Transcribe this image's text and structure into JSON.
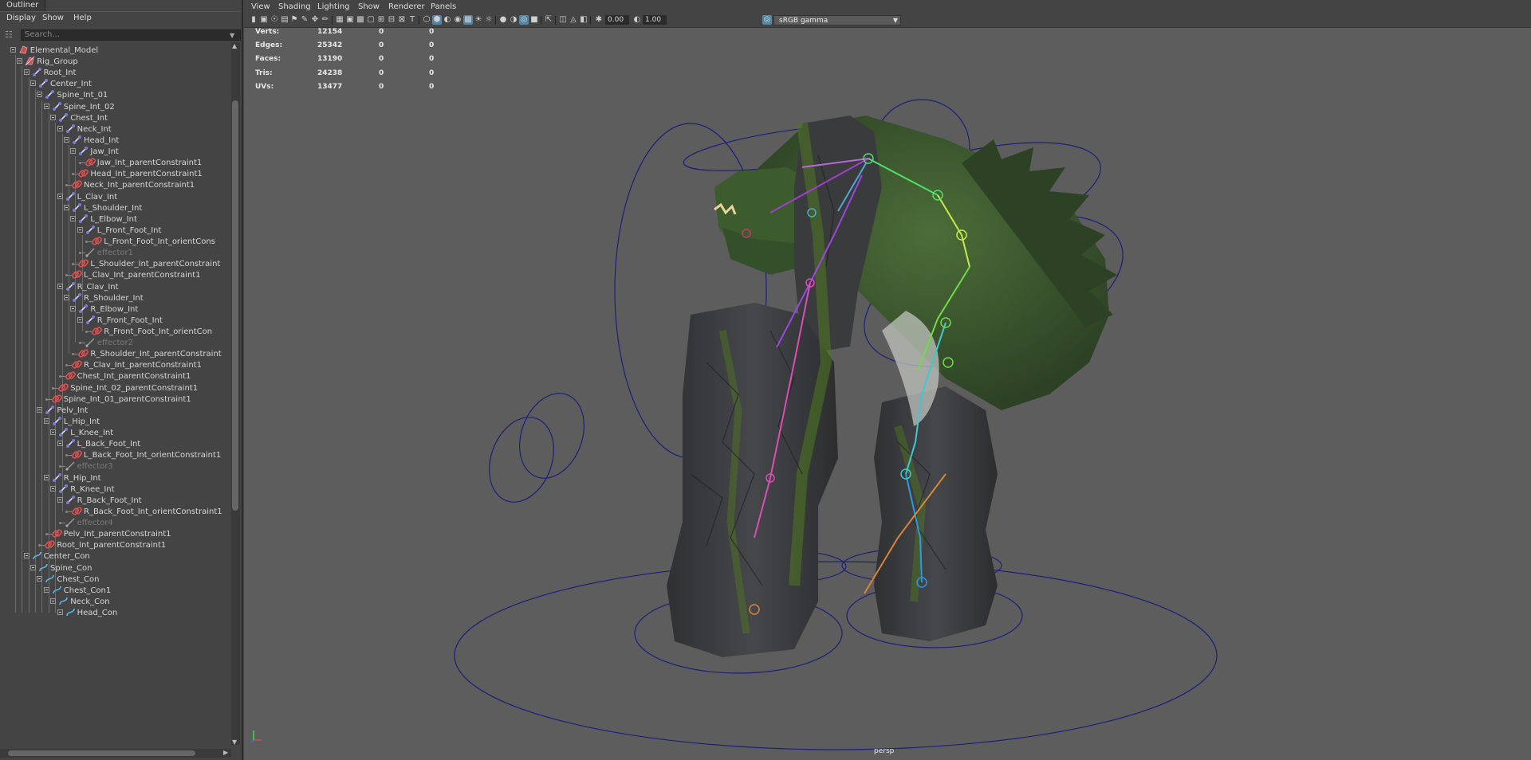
{
  "outliner": {
    "tab": "Outliner",
    "menu": [
      "Display",
      "Show",
      "Help"
    ],
    "search_placeholder": "Search...",
    "items": [
      {
        "label": "Elemental_Model",
        "depth": 2,
        "icon": "mesh",
        "expand": true
      },
      {
        "label": "Rig_Group",
        "depth": 3,
        "icon": "group",
        "expand": true
      },
      {
        "label": "Root_Int",
        "depth": 4,
        "icon": "joint",
        "expand": true
      },
      {
        "label": "Center_Int",
        "depth": 5,
        "icon": "joint",
        "expand": true
      },
      {
        "label": "Spine_Int_01",
        "depth": 6,
        "icon": "joint",
        "expand": true
      },
      {
        "label": "Spine_Int_02",
        "depth": 7,
        "icon": "joint",
        "expand": true
      },
      {
        "label": "Chest_Int",
        "depth": 8,
        "icon": "joint",
        "expand": true
      },
      {
        "label": "Neck_Int",
        "depth": 9,
        "icon": "joint",
        "expand": true
      },
      {
        "label": "Head_Int",
        "depth": 10,
        "icon": "joint",
        "expand": true
      },
      {
        "label": "Jaw_Int",
        "depth": 11,
        "icon": "joint",
        "expand": true
      },
      {
        "label": "Jaw_Int_parentConstraint1",
        "depth": 12,
        "icon": "constraint",
        "expand": false
      },
      {
        "label": "Head_Int_parentConstraint1",
        "depth": 11,
        "icon": "constraint",
        "expand": false
      },
      {
        "label": "Neck_Int_parentConstraint1",
        "depth": 10,
        "icon": "constraint",
        "expand": false
      },
      {
        "label": "L_Clav_Int",
        "depth": 9,
        "icon": "joint",
        "expand": true
      },
      {
        "label": "L_Shoulder_Int",
        "depth": 10,
        "icon": "joint",
        "expand": true
      },
      {
        "label": "L_Elbow_Int",
        "depth": 11,
        "icon": "joint",
        "expand": true
      },
      {
        "label": "L_Front_Foot_Int",
        "depth": 12,
        "icon": "joint",
        "expand": true
      },
      {
        "label": "L_Front_Foot_Int_orientCons",
        "depth": 13,
        "icon": "constraint",
        "expand": false
      },
      {
        "label": "effector1",
        "depth": 12,
        "icon": "effector",
        "expand": false,
        "dim": true
      },
      {
        "label": "L_Shoulder_Int_parentConstraint",
        "depth": 11,
        "icon": "constraint",
        "expand": false
      },
      {
        "label": "L_Clav_Int_parentConstraint1",
        "depth": 10,
        "icon": "constraint",
        "expand": false
      },
      {
        "label": "R_Clav_Int",
        "depth": 9,
        "icon": "joint",
        "expand": true
      },
      {
        "label": "R_Shoulder_Int",
        "depth": 10,
        "icon": "joint",
        "expand": true
      },
      {
        "label": "R_Elbow_Int",
        "depth": 11,
        "icon": "joint",
        "expand": true
      },
      {
        "label": "R_Front_Foot_Int",
        "depth": 12,
        "icon": "joint",
        "expand": true
      },
      {
        "label": "R_Front_Foot_Int_orientCon",
        "depth": 13,
        "icon": "constraint",
        "expand": false
      },
      {
        "label": "effector2",
        "depth": 12,
        "icon": "effector",
        "expand": false,
        "dim": true
      },
      {
        "label": "R_Shoulder_Int_parentConstraint",
        "depth": 11,
        "icon": "constraint",
        "expand": false
      },
      {
        "label": "R_Clav_Int_parentConstraint1",
        "depth": 10,
        "icon": "constraint",
        "expand": false
      },
      {
        "label": "Chest_Int_parentConstraint1",
        "depth": 9,
        "icon": "constraint",
        "expand": false
      },
      {
        "label": "Spine_Int_02_parentConstraint1",
        "depth": 8,
        "icon": "constraint",
        "expand": false
      },
      {
        "label": "Spine_Int_01_parentConstraint1",
        "depth": 7,
        "icon": "constraint",
        "expand": false
      },
      {
        "label": "Pelv_Int",
        "depth": 6,
        "icon": "joint",
        "expand": true
      },
      {
        "label": "L_Hip_Int",
        "depth": 7,
        "icon": "joint",
        "expand": true
      },
      {
        "label": "L_Knee_Int",
        "depth": 8,
        "icon": "joint",
        "expand": true
      },
      {
        "label": "L_Back_Foot_Int",
        "depth": 9,
        "icon": "joint",
        "expand": true
      },
      {
        "label": "L_Back_Foot_Int_orientConstraint1",
        "depth": 10,
        "icon": "constraint",
        "expand": false
      },
      {
        "label": "effector3",
        "depth": 9,
        "icon": "effector",
        "expand": false,
        "dim": true
      },
      {
        "label": "R_Hip_Int",
        "depth": 7,
        "icon": "joint",
        "expand": true
      },
      {
        "label": "R_Knee_Int",
        "depth": 8,
        "icon": "joint",
        "expand": true
      },
      {
        "label": "R_Back_Foot_Int",
        "depth": 9,
        "icon": "joint",
        "expand": true
      },
      {
        "label": "R_Back_Foot_Int_orientConstraint1",
        "depth": 10,
        "icon": "constraint",
        "expand": false
      },
      {
        "label": "effector4",
        "depth": 9,
        "icon": "effector",
        "expand": false,
        "dim": true
      },
      {
        "label": "Pelv_Int_parentConstraint1",
        "depth": 7,
        "icon": "constraint",
        "expand": false
      },
      {
        "label": "Root_Int_parentConstraint1",
        "depth": 6,
        "icon": "constraint",
        "expand": false
      },
      {
        "label": "Center_Con",
        "depth": 4,
        "icon": "curve",
        "expand": true
      },
      {
        "label": "Spine_Con",
        "depth": 5,
        "icon": "curve",
        "expand": true
      },
      {
        "label": "Chest_Con",
        "depth": 6,
        "icon": "curve",
        "expand": true
      },
      {
        "label": "Chest_Con1",
        "depth": 7,
        "icon": "curve",
        "expand": true
      },
      {
        "label": "Neck_Con",
        "depth": 8,
        "icon": "curve",
        "expand": true
      },
      {
        "label": "Head_Con",
        "depth": 9,
        "icon": "curve",
        "expand": true
      }
    ]
  },
  "viewport": {
    "menu": [
      "View",
      "Shading",
      "Lighting",
      "Show",
      "Renderer",
      "Panels"
    ],
    "exposure": "0.00",
    "gamma_value": "1.00",
    "color_space": "sRGB gamma",
    "camera": "persp",
    "hud": [
      {
        "label": "Verts:",
        "values": [
          "12154",
          "0",
          "0"
        ]
      },
      {
        "label": "Edges:",
        "values": [
          "25342",
          "0",
          "0"
        ]
      },
      {
        "label": "Faces:",
        "values": [
          "13190",
          "0",
          "0"
        ]
      },
      {
        "label": "Tris:",
        "values": [
          "24238",
          "0",
          "0"
        ]
      },
      {
        "label": "UVs:",
        "values": [
          "13477",
          "0",
          "0"
        ]
      }
    ],
    "colors": {
      "background": "#5d5d5d",
      "rock": "#3a3b3d",
      "moss": "#4f7a1f",
      "controls": "#1c1f7a",
      "toolbar_active": "#5285a6"
    }
  }
}
